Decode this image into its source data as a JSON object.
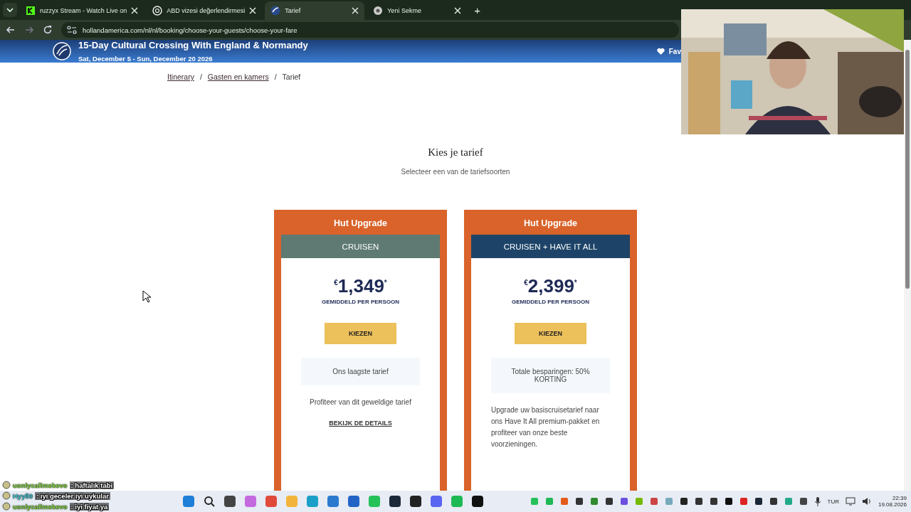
{
  "browser": {
    "tabs": [
      {
        "title": "ruzzyx Stream - Watch Live on",
        "selected": false,
        "kind": "stream"
      },
      {
        "title": "ABD vizesi değerlendirmesi",
        "selected": false,
        "kind": "chat"
      },
      {
        "title": "Tarief",
        "selected": true,
        "kind": "ship"
      },
      {
        "title": "Yeni Sekme",
        "selected": false,
        "kind": "chrome"
      }
    ],
    "new_tab": "+",
    "address": "hollandamerica.com/nl/nl/booking/choose-your-guests/choose-your-fare"
  },
  "header": {
    "title": "15-Day Cultural Crossing With England & Normandy",
    "dates": "Sat, December 5 - Sun, December 20 2026",
    "favorite": "Fav"
  },
  "breadcrumb": [
    {
      "label": "Itinerary",
      "link": true
    },
    {
      "label": "Gasten en kamers",
      "link": true
    },
    {
      "label": "Tarief",
      "link": false
    }
  ],
  "separator": "/",
  "heading": "Kies je tarief",
  "subheading": "Selecteer een van de tariefsoorten",
  "fares": [
    {
      "upgrade": "Hut Upgrade",
      "name": "CRUISEN",
      "color": "#5e7a73",
      "price": "$^{€}$1,349$^{*}$",
      "price_note": "GEMIDDELD PER PERSOON",
      "button": "KIEZEN",
      "highlight": "Ons laagste tarief",
      "description": "Profiteer van dit geweldige tarief",
      "details_link": "BEKIJK DE DETAILS"
    },
    {
      "upgrade": "Hut Upgrade",
      "name": "CRUISEN + HAVE IT ALL",
      "color": "#1d4468",
      "price": "$^{€}$2,399$^{*}$",
      "price_note": "GEMIDDELD PER PERSOON",
      "button": "KIEZEN",
      "highlight": "Totale besparingen: 50% KORTING",
      "description": "Upgrade uw basiscruisetarief naar ons Have It All premium-pakket en profiteer van onze beste voorzieningen."
    }
  ],
  "chat": [
    {
      "user": "uonlycallmekevo",
      "color": "#7ed23c",
      "message": ": haftalık tabi"
    },
    {
      "user": "Hyyll0",
      "color": "#3ec3cf",
      "message": ": iyi geceler iyi uykular"
    },
    {
      "user": "uonlycallmekevo",
      "color": "#7ed23c",
      "message": ": iyi fiyat ya"
    }
  ],
  "taskbar": {
    "language": "TUR",
    "time": "22:39",
    "date": "19.08.2026"
  }
}
